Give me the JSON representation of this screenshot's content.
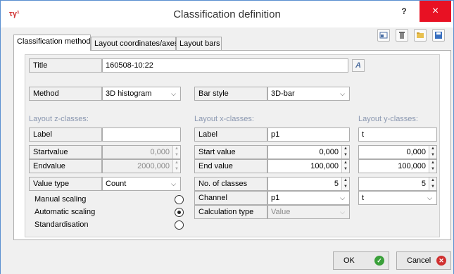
{
  "window": {
    "title": "Classification definition",
    "app_icon": "τγ¹",
    "help": "?",
    "close": "×"
  },
  "tabs": [
    {
      "label": "Classification method",
      "active": true
    },
    {
      "label": "Layout coordinates/axes",
      "active": false
    },
    {
      "label": "Layout bars",
      "active": false
    }
  ],
  "toolbar": {
    "icons": [
      "properties-icon",
      "delete-icon",
      "open-folder-icon",
      "save-icon"
    ]
  },
  "title_row": {
    "label": "Title",
    "value": "160508-10:22",
    "font_button": "A"
  },
  "method": {
    "label": "Method",
    "value": "3D histogram"
  },
  "bar_style": {
    "label": "Bar style",
    "value": "3D-bar"
  },
  "z_classes": {
    "heading": "Layout z-classes:",
    "label_label": "Label",
    "label_value": "",
    "start_label": "Startvalue",
    "start_value": "0,000",
    "end_label": "Endvalue",
    "end_value": "2000,000",
    "type_label": "Value type",
    "type_value": "Count"
  },
  "scaling": {
    "manual": "Manual scaling",
    "automatic": "Automatic scaling",
    "standard": "Standardisation",
    "selected": "automatic"
  },
  "x_classes": {
    "heading": "Layout x-classes:",
    "label_label": "Label",
    "label_value": "p1",
    "start_label": "Start value",
    "start_value": "0,000",
    "end_label": "End value",
    "end_value": "100,000",
    "num_label": "No. of classes",
    "num_value": "5",
    "channel_label": "Channel",
    "channel_value": "p1",
    "calc_label": "Calculation type",
    "calc_value": "Value"
  },
  "y_classes": {
    "heading": "Layout y-classes:",
    "label_value": "t",
    "start_value": "0,000",
    "end_value": "100,000",
    "num_value": "5",
    "channel_value": "t"
  },
  "footer": {
    "ok": "OK",
    "cancel": "Cancel"
  },
  "colors": {
    "ok_icon": "#3aa03a",
    "cancel_icon": "#d03030",
    "close_bg": "#e81123"
  }
}
